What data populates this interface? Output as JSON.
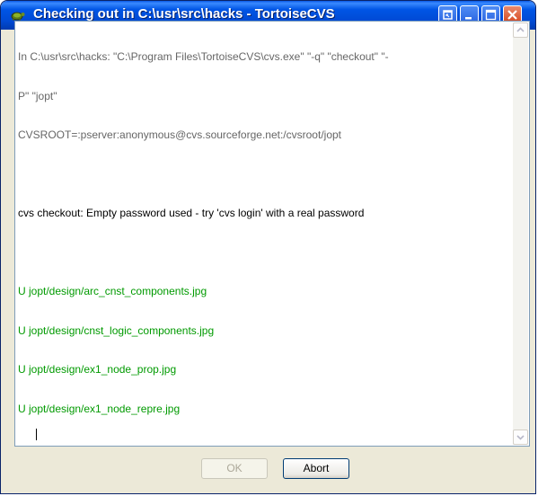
{
  "window": {
    "title": "Checking out in C:\\usr\\src\\hacks - TortoiseCVS",
    "icon": "tortoise-icon",
    "controls": [
      "restore-dialog-icon",
      "minimize-icon",
      "maximize-icon",
      "close-icon"
    ]
  },
  "log": {
    "lines": [
      {
        "text": "In C:\\usr\\src\\hacks: \"C:\\Program Files\\TortoiseCVS\\cvs.exe\" \"-q\" \"checkout\" \"-",
        "color": "gray"
      },
      {
        "text": "P\" \"jopt\"",
        "color": "gray"
      },
      {
        "text": "CVSROOT=:pserver:anonymous@cvs.sourceforge.net:/cvsroot/jopt",
        "color": "gray"
      },
      {
        "text": "",
        "color": "blank"
      },
      {
        "text": "cvs checkout: Empty password used - try 'cvs login' with a real password",
        "color": "black"
      },
      {
        "text": "",
        "color": "blank"
      },
      {
        "text": "U jopt/design/arc_cnst_components.jpg",
        "color": "green"
      },
      {
        "text": "U jopt/design/cnst_logic_components.jpg",
        "color": "green"
      },
      {
        "text": "U jopt/design/ex1_node_prop.jpg",
        "color": "green"
      },
      {
        "text": "U jopt/design/ex1_node_repre.jpg",
        "color": "green"
      }
    ]
  },
  "buttons": {
    "ok_label": "OK",
    "ok_enabled": false,
    "abort_label": "Abort"
  },
  "colors": {
    "title_bar": "#0055e5",
    "log_gray": "#666666",
    "log_green": "#009a00",
    "dialog_bg": "#ece9d8"
  }
}
